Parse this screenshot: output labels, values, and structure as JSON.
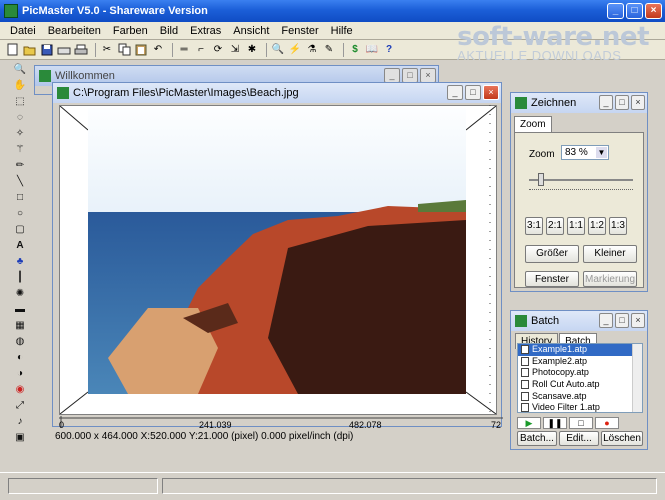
{
  "app": {
    "title": "PicMaster V5.0 - Shareware Version"
  },
  "watermark": {
    "main": "soft-ware.net",
    "sub": "AKTUELLE DOWNLOADS"
  },
  "menu": [
    "Datei",
    "Bearbeiten",
    "Farben",
    "Bild",
    "Extras",
    "Ansicht",
    "Fenster",
    "Hilfe"
  ],
  "welcome_window": {
    "title": "Willkommen"
  },
  "image_window": {
    "title": "C:\\Program Files\\PicMaster\\Images\\Beach.jpg",
    "ruler_labels": [
      "0",
      "241.039",
      "482.078",
      "72"
    ],
    "status": "600.000 x 464.000    X:520.000  Y:21.000 (pixel)  0.000 pixel/inch (dpi)"
  },
  "zeichnen": {
    "title": "Zeichnen",
    "tab": "Zoom",
    "zoom_label": "Zoom",
    "zoom_value": "83 %",
    "zoom_slider_fraction": 0.12,
    "ratio_buttons": [
      "3:1",
      "2:1",
      "1:1",
      "1:2",
      "1:3"
    ],
    "btn_bigger": "Größer",
    "btn_smaller": "Kleiner",
    "btn_window": "Fenster",
    "btn_selection": "Markierung"
  },
  "batch": {
    "title": "Batch",
    "tabs": [
      "History",
      "Batch"
    ],
    "items": [
      "Example1.atp",
      "Example2.atp",
      "Photocopy.atp",
      "Roll Cut Auto.atp",
      "Scansave.atp",
      "Video Filter 1.atp"
    ],
    "btn_batch": "Batch...",
    "btn_edit": "Edit...",
    "btn_delete": "Löschen"
  }
}
